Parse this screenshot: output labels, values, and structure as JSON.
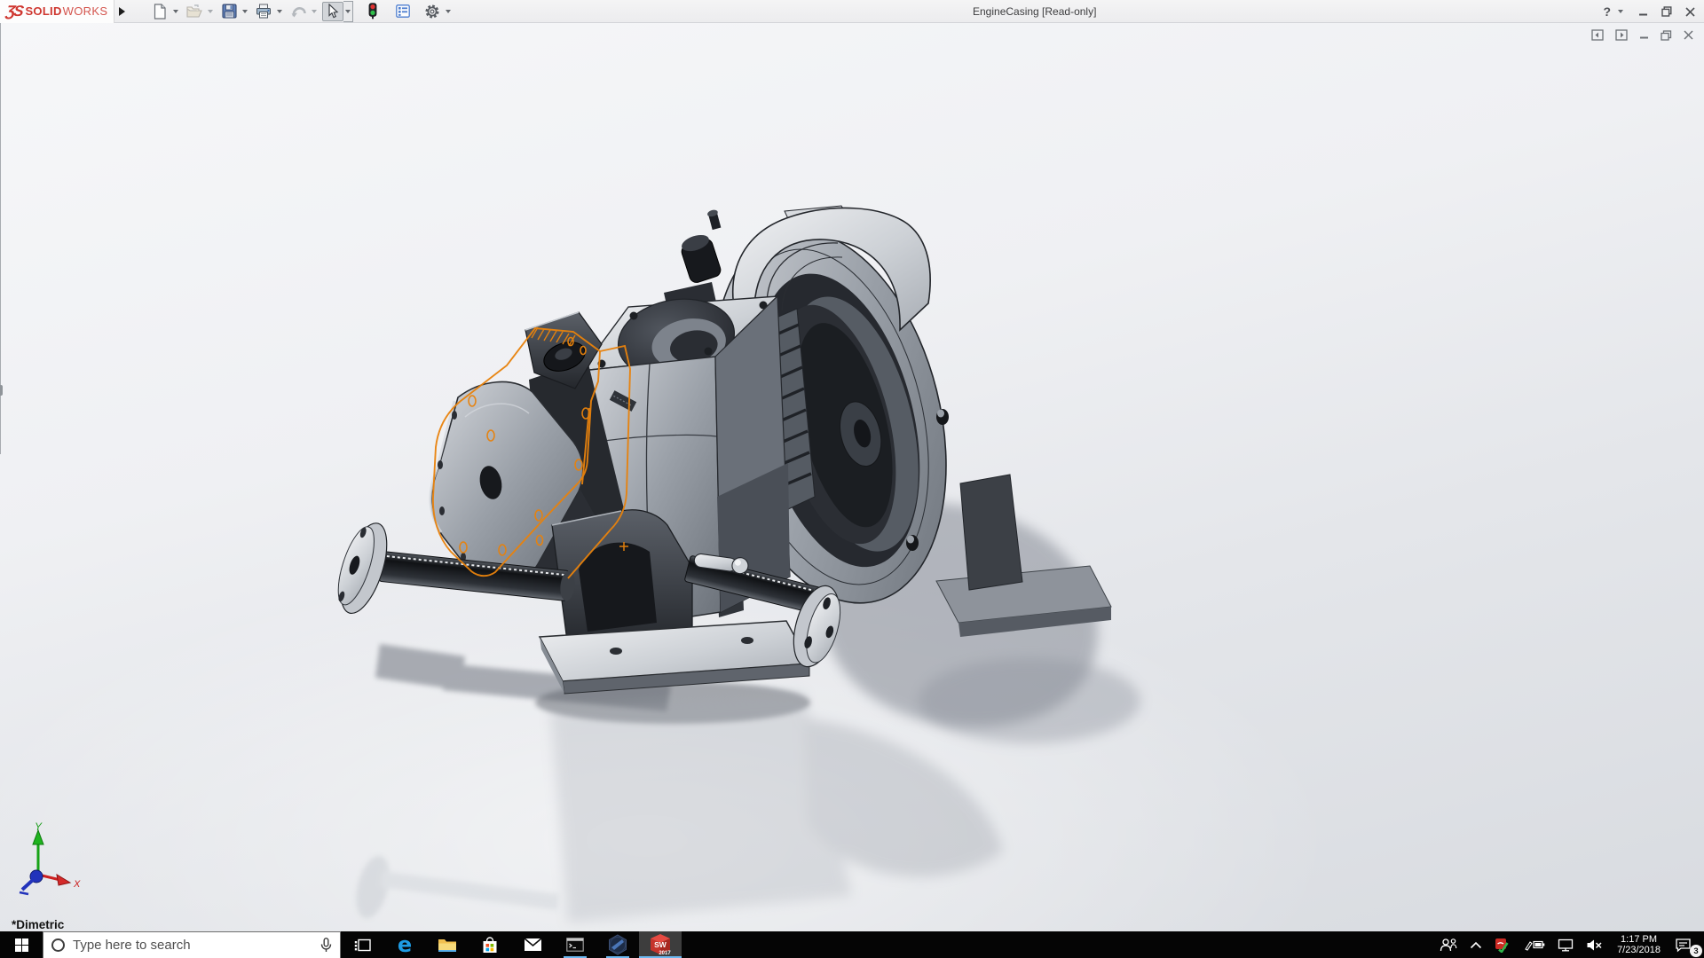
{
  "titlebar": {
    "brand": {
      "mark": "ƷS",
      "solid": "SOLID",
      "works": "WORKS"
    },
    "title": "EngineCasing [Read-only]",
    "help_glyph": "?"
  },
  "viewport": {
    "view_label": "*Dimetric",
    "triad": {
      "x_label": "X",
      "y_label": "Y"
    }
  },
  "taskbar": {
    "search_placeholder": "Type here to search",
    "edge_glyph": "e",
    "sw_letters": "SW",
    "sw_year": "2017",
    "tray": {
      "time": "1:17 PM",
      "date": "7/23/2018",
      "notification_count": "3"
    }
  },
  "colors": {
    "sketch_orange": "#e8820c",
    "brand_red": "#cf3730",
    "taskbar_indicator": "#6cb8f0",
    "viewport_top": "#f6f7f9",
    "viewport_bottom": "#d8dbe0"
  }
}
